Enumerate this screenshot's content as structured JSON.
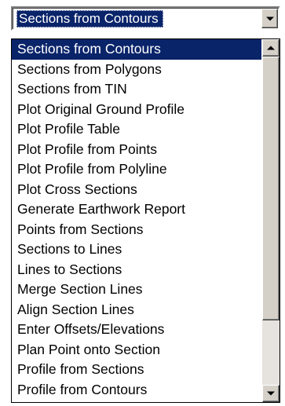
{
  "combo": {
    "selected_value": "Sections from Contours"
  },
  "dropdown": {
    "selected_index": 0,
    "items": [
      "Sections from Contours",
      "Sections from Polygons",
      "Sections from TIN",
      "Plot Original Ground Profile",
      "Plot Profile Table",
      "Plot Profile from Points",
      "Plot Profile from Polyline",
      "Plot Cross Sections",
      "Generate Earthwork Report",
      "Points from Sections",
      "Sections to Lines",
      "Lines to Sections",
      "Merge Section Lines",
      "Align Section Lines",
      "Enter Offsets/Elevations",
      "Plan Point onto Section",
      "Profile from Sections",
      "Profile from Contours"
    ]
  },
  "scrollbar": {
    "position_fraction": 0.0
  },
  "colors": {
    "selection_background": "#0a246a",
    "selection_text": "#ffffff",
    "control_face": "#d4d0c8"
  },
  "icons": {
    "combo_button": "chevron-down-icon",
    "scroll_up": "scroll-up-arrow-icon",
    "scroll_down": "scroll-down-arrow-icon"
  }
}
